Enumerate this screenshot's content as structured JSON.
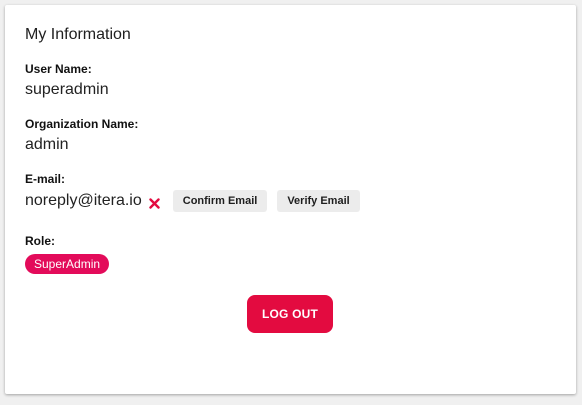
{
  "card": {
    "title": "My Information"
  },
  "fields": {
    "user_name": {
      "label": "User Name:",
      "value": "superadmin"
    },
    "organization": {
      "label": "Organization Name:",
      "value": "admin"
    },
    "email": {
      "label": "E-mail:",
      "value": "noreply@itera.io",
      "status_icon": "x-icon",
      "status_color": "#e30b40",
      "confirm_label": "Confirm Email",
      "verify_label": "Verify Email"
    },
    "role": {
      "label": "Role:",
      "value": "SuperAdmin",
      "badge_color": "#e30b5a"
    }
  },
  "actions": {
    "logout_label": "LOG OUT",
    "logout_color": "#e30b40"
  }
}
